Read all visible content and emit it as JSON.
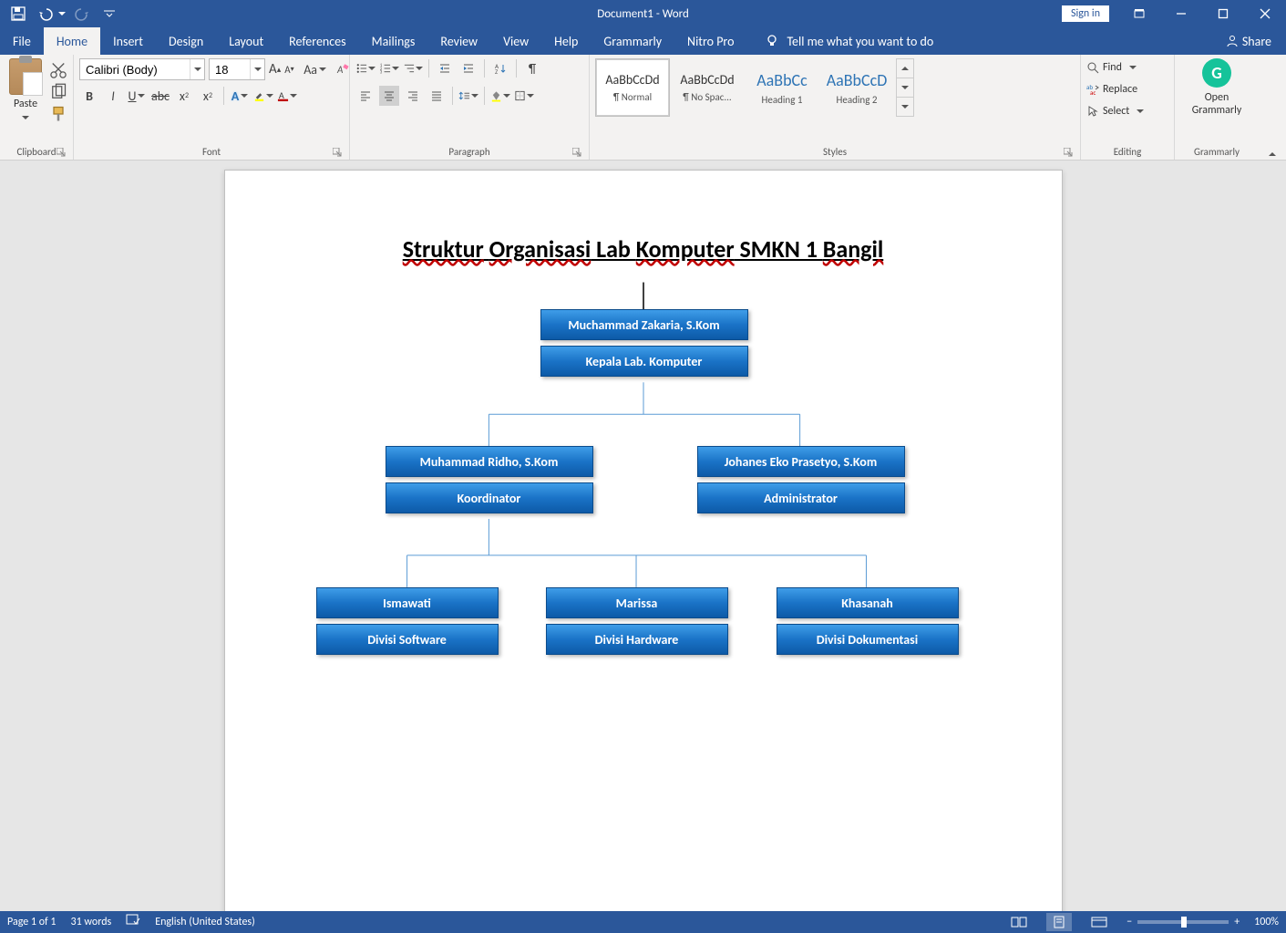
{
  "window": {
    "title": "Document1  -  Word",
    "sign_in": "Sign in"
  },
  "tabs": [
    "File",
    "Home",
    "Insert",
    "Design",
    "Layout",
    "References",
    "Mailings",
    "Review",
    "View",
    "Help",
    "Grammarly",
    "Nitro Pro"
  ],
  "active_tab": "Home",
  "tellme_placeholder": "Tell me what you want to do",
  "share_label": "Share",
  "ribbon": {
    "clipboard": {
      "label": "Clipboard",
      "paste_label": "Paste"
    },
    "font": {
      "label": "Font",
      "font_name": "Calibri (Body)",
      "font_size": "18"
    },
    "paragraph": {
      "label": "Paragraph"
    },
    "styles": {
      "label": "Styles",
      "items": [
        {
          "preview": "AaBbCcDd",
          "name": "¶ Normal",
          "selected": true,
          "cls": ""
        },
        {
          "preview": "AaBbCcDd",
          "name": "¶ No Spac...",
          "selected": false,
          "cls": ""
        },
        {
          "preview": "AaBbCc",
          "name": "Heading 1",
          "selected": false,
          "cls": "h1"
        },
        {
          "preview": "AaBbCcD",
          "name": "Heading 2",
          "selected": false,
          "cls": "h2"
        }
      ]
    },
    "editing": {
      "label": "Editing",
      "find": "Find",
      "replace": "Replace",
      "select": "Select"
    },
    "grammarly": {
      "label": "Grammarly",
      "open_line1": "Open",
      "open_line2": "Grammarly"
    }
  },
  "document": {
    "title_parts": [
      {
        "text": "Struktur",
        "squig": true
      },
      {
        "text": " "
      },
      {
        "text": "Organisasi",
        "squig": true
      },
      {
        "text": " Lab "
      },
      {
        "text": "Komputer",
        "squig": true
      },
      {
        "text": " SMKN 1 "
      },
      {
        "text": "Bangil",
        "squig": true
      }
    ],
    "boxes": {
      "l1_name": "Muchammad Zakaria, S.Kom",
      "l1_role": "Kepala Lab. Komputer",
      "l2a_name": "Muhammad Ridho, S.Kom",
      "l2a_role": "Koordinator",
      "l2b_name": "Johanes Eko Prasetyo, S.Kom",
      "l2b_role": "Administrator",
      "l3a_name": "Ismawati",
      "l3a_role": "Divisi  Software",
      "l3b_name": "Marissa",
      "l3b_role": "Divisi  Hardware",
      "l3c_name": "Khasanah",
      "l3c_role": "Divisi  Dokumentasi"
    }
  },
  "statusbar": {
    "page": "Page 1 of 1",
    "words": "31 words",
    "language": "English (United States)",
    "zoom": "100%"
  }
}
